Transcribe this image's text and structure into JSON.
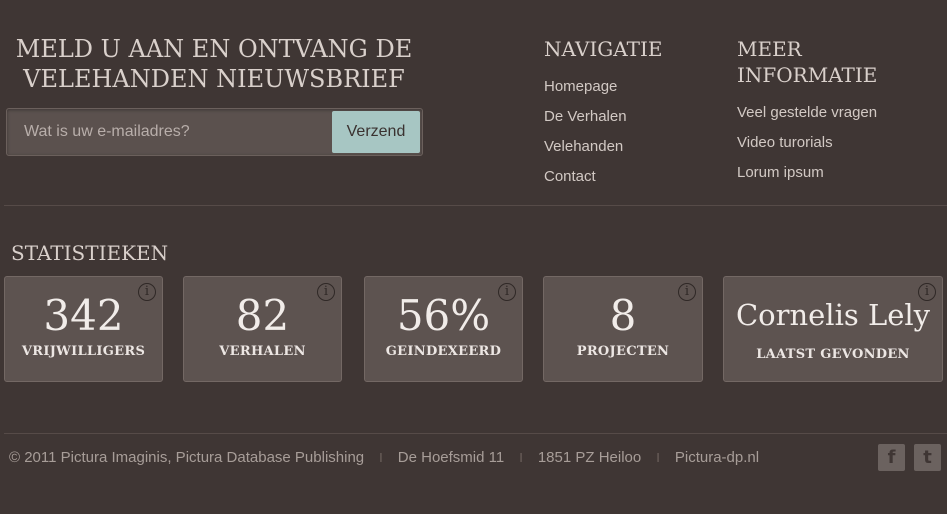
{
  "newsletter": {
    "title_line1": "MELD U AAN EN ONTVANG DE",
    "title_line2": "VELEHANDEN NIEUWSBRIEF",
    "email_placeholder": "Wat is uw e-mailadres?",
    "submit_label": "Verzend"
  },
  "navigatie": {
    "title": "NAVIGATIE",
    "items": [
      "Homepage",
      "De Verhalen",
      "Velehanden",
      "Contact"
    ]
  },
  "meer_informatie": {
    "title": "MEER INFORMATIE",
    "items": [
      "Veel gestelde vragen",
      "Video turorials",
      "Lorum ipsum"
    ]
  },
  "statistieken": {
    "title": "STATISTIEKEN",
    "cards": [
      {
        "value": "342",
        "label": "VRIJWILLIGERS"
      },
      {
        "value": "82",
        "label": "VERHALEN"
      },
      {
        "value": "56%",
        "label": "GEINDEXEERD"
      },
      {
        "value": "8",
        "label": "PROJECTEN"
      },
      {
        "value": "Cornelis Lely",
        "label": "LAATST GEVONDEN"
      }
    ],
    "info_glyph": "i"
  },
  "footer": {
    "copyright": "© 2011 Pictura Imaginis, Pictura Database Publishing",
    "address": "De Hoefsmid 11",
    "postcode": "1851 PZ Heiloo",
    "website": "Pictura-dp.nl",
    "separator": "I",
    "facebook_glyph": "f",
    "twitter_glyph": "t"
  },
  "colors": {
    "background": "#3f3634",
    "card": "#5d5350",
    "button": "#a7c6c3"
  }
}
